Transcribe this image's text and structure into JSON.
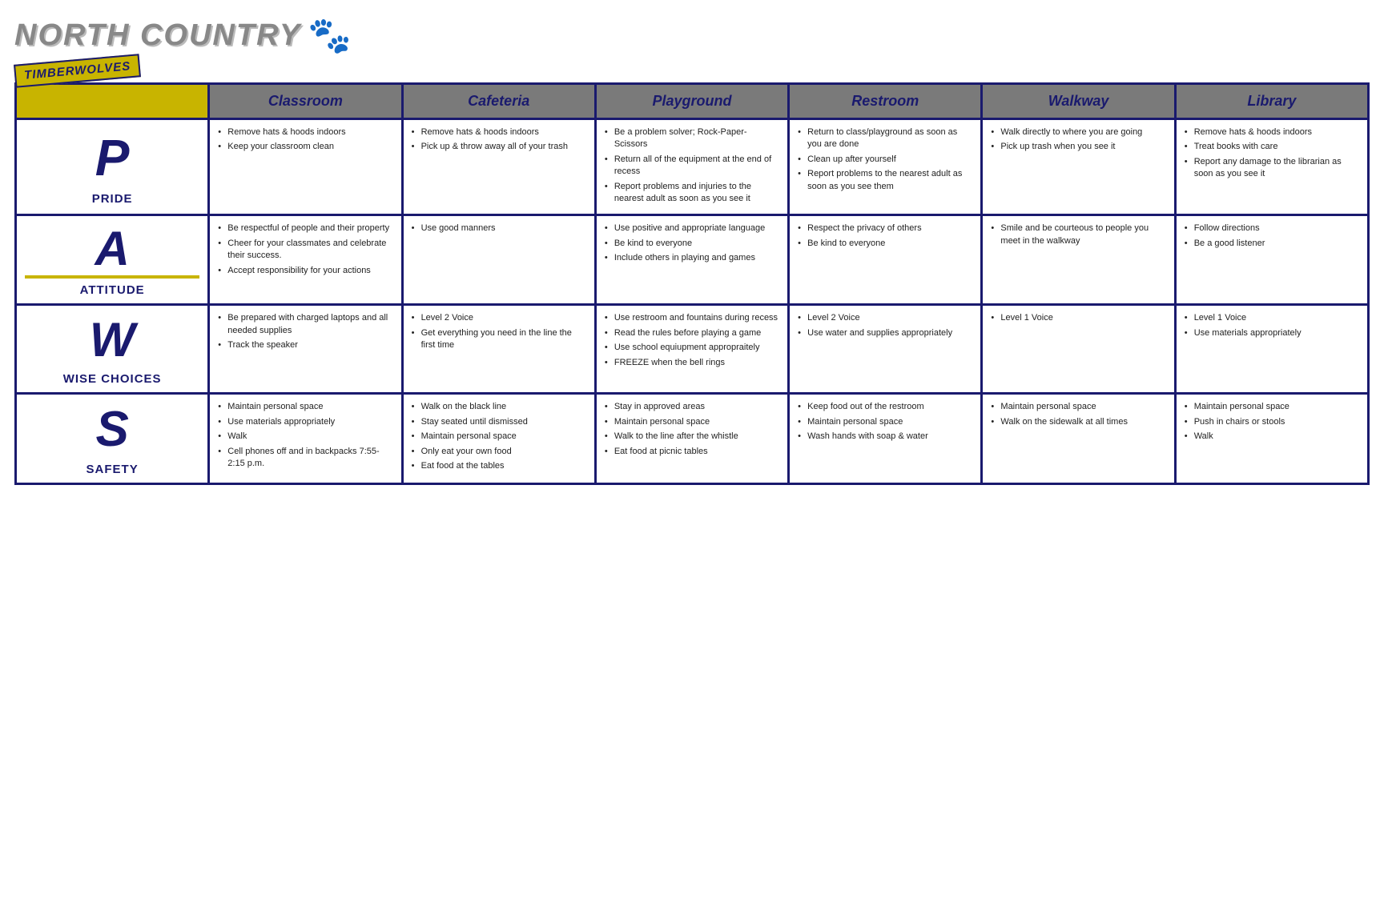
{
  "header": {
    "school_name": "NORTH COUNTRY",
    "mascot": "TIMBERWOLVES",
    "paw_icon": "🐾"
  },
  "columns": [
    "Classroom",
    "Cafeteria",
    "Playground",
    "Restroom",
    "Walkway",
    "Library"
  ],
  "rows": [
    {
      "letter": "P",
      "word": "PRIDE",
      "cells": {
        "classroom": [
          "Remove hats & hoods indoors",
          "Keep your classroom clean"
        ],
        "cafeteria": [
          "Remove hats & hoods indoors",
          "Pick up & throw away all of your trash"
        ],
        "playground": [
          "Be a problem solver; Rock-Paper-Scissors",
          "Return all of the equipment at the end of recess",
          "Report problems and injuries to the nearest adult as soon as you see it"
        ],
        "restroom": [
          "Return to class/playground as soon as you are done",
          "Clean up after yourself",
          "Report problems to the nearest adult as soon as you see them"
        ],
        "walkway": [
          "Walk directly to where you are going",
          "Pick up trash when you see it"
        ],
        "library": [
          "Remove hats & hoods indoors",
          "Treat books with care",
          "Report any damage to the librarian as soon as you see it"
        ]
      }
    },
    {
      "letter": "A",
      "word": "ATTITUDE",
      "cells": {
        "classroom": [
          "Be respectful of people and their property",
          "Cheer for your classmates and celebrate their success.",
          "Accept responsibility for your actions"
        ],
        "cafeteria": [
          "Use good manners"
        ],
        "playground": [
          "Use positive and appropriate language",
          "Be kind to everyone",
          "Include others in playing and games"
        ],
        "restroom": [
          "Respect the privacy of others",
          "Be kind to everyone"
        ],
        "walkway": [
          "Smile and be courteous to people you meet in the walkway"
        ],
        "library": [
          "Follow directions",
          "Be a good listener"
        ]
      }
    },
    {
      "letter": "W",
      "word": "WISE CHOICES",
      "cells": {
        "classroom": [
          "Be prepared with charged laptops and all needed supplies",
          "Track the speaker"
        ],
        "cafeteria": [
          "Level 2 Voice",
          "Get everything you need in the line the first time"
        ],
        "playground": [
          "Use restroom and fountains during recess",
          "Read the rules before playing a game",
          "Use school equiupment appropraitely",
          "FREEZE when the bell rings"
        ],
        "restroom": [
          "Level 2 Voice",
          "Use water and supplies appropriately"
        ],
        "walkway": [
          "Level 1 Voice"
        ],
        "library": [
          "Level 1 Voice",
          "Use materials appropriately"
        ]
      }
    },
    {
      "letter": "S",
      "word": "SAFETY",
      "cells": {
        "classroom": [
          "Maintain personal space",
          "Use materials appropriately",
          "Walk",
          "Cell phones off and in backpacks 7:55-2:15 p.m."
        ],
        "cafeteria": [
          "Walk on the black line",
          "Stay seated until dismissed",
          "Maintain personal space",
          "Only eat your own food",
          "Eat food at the tables"
        ],
        "playground": [
          "Stay in approved areas",
          "Maintain personal space",
          "Walk to the line after the whistle",
          "Eat food at picnic tables"
        ],
        "restroom": [
          "Keep food out of the restroom",
          "Maintain personal space",
          "Wash hands with soap & water"
        ],
        "walkway": [
          "Maintain personal space",
          "Walk on the sidewalk at all times"
        ],
        "library": [
          "Maintain personal space",
          "Push in chairs or stools",
          "Walk"
        ]
      }
    }
  ]
}
